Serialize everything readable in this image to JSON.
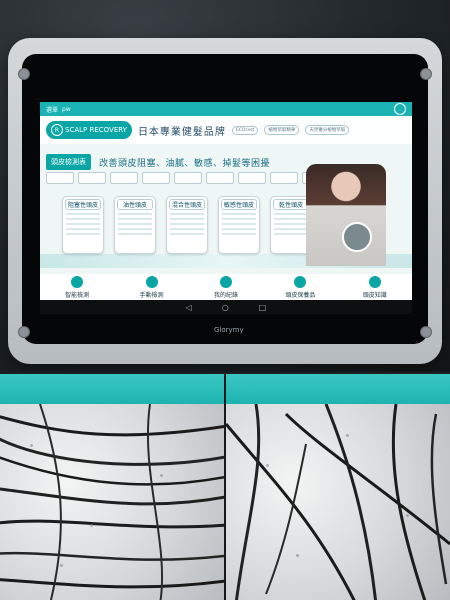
{
  "status_bar": {
    "left_label": "選單",
    "left_sub": "pw"
  },
  "brand": {
    "logo_text": "SCALP RECOVERY",
    "title": "日本專業健髮品牌",
    "pills": [
      "ECOcert",
      "植物萃取精華",
      "天然養分植物萃取"
    ]
  },
  "section": {
    "tab_label": "頭皮檢測表",
    "slogan": "改善頭皮阻塞、油膩、敏感、掉髮等困擾"
  },
  "cards": [
    {
      "title": "阻塞性頭皮",
      "text": "清除毛孔阻塞"
    },
    {
      "title": "油性頭皮",
      "text": "控油保濕"
    },
    {
      "title": "混合性頭皮",
      "text": "平衡油水"
    },
    {
      "title": "敏感性頭皮",
      "text": "舒緩修護"
    },
    {
      "title": "乾性頭皮",
      "text": "補水滋潤"
    }
  ],
  "nav": {
    "items": [
      "智能檢測",
      "手動檢測",
      "我的紀錄",
      "頭皮保養品",
      "頭皮知識"
    ]
  },
  "system_bar": {
    "back": "◁",
    "home": "○",
    "recent": "□"
  },
  "tablet_brand": "Glorymy"
}
